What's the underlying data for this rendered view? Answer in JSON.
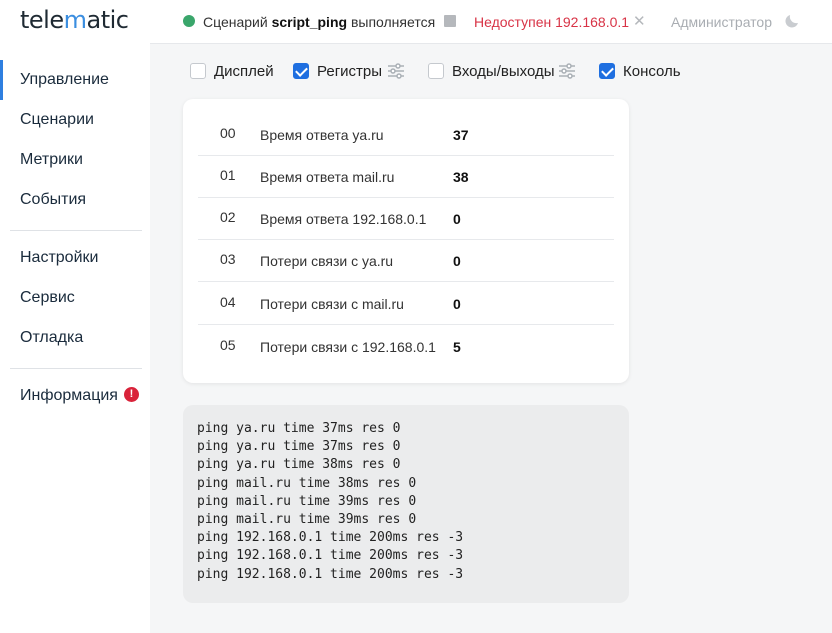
{
  "logo": {
    "text_a": "tele",
    "text_b": "m",
    "text_c": "atic"
  },
  "sidebar": {
    "items": [
      {
        "label": "Управление",
        "active": true
      },
      {
        "label": "Сценарии"
      },
      {
        "label": "Метрики"
      },
      {
        "label": "События"
      },
      {
        "label": "Настройки"
      },
      {
        "label": "Сервис"
      },
      {
        "label": "Отладка"
      },
      {
        "label": "Информация",
        "badge": "!"
      }
    ]
  },
  "topbar": {
    "status_prefix": "Сценарий",
    "script_name": "script_ping",
    "status_suffix": "выполняется",
    "status_color": "#3aa66b",
    "unreachable": "Недоступен 192.168.0.1",
    "unreachable_color": "#d83346",
    "user": "Администратор"
  },
  "toggles": [
    {
      "label": "Дисплей",
      "checked": false
    },
    {
      "label": "Регистры",
      "checked": true
    },
    {
      "label": "Входы/выходы",
      "checked": false
    },
    {
      "label": "Консоль",
      "checked": true
    }
  ],
  "registers": [
    {
      "index": "00",
      "name": "Время ответа ya.ru",
      "value": "37"
    },
    {
      "index": "01",
      "name": "Время ответа mail.ru",
      "value": "38"
    },
    {
      "index": "02",
      "name": "Время ответа 192.168.0.1",
      "value": "0"
    },
    {
      "index": "03",
      "name": "Потери связи с ya.ru",
      "value": "0"
    },
    {
      "index": "04",
      "name": "Потери связи с mail.ru",
      "value": "0"
    },
    {
      "index": "05",
      "name": "Потери связи с 192.168.0.1",
      "value": "5"
    }
  ],
  "console": [
    "ping ya.ru time 37ms res 0",
    "ping ya.ru time 37ms res 0",
    "ping ya.ru time 38ms res 0",
    "ping mail.ru time 38ms res 0",
    "ping mail.ru time 39ms res 0",
    "ping mail.ru time 39ms res 0",
    "ping 192.168.0.1 time 200ms res -3",
    "ping 192.168.0.1 time 200ms res -3",
    "ping 192.168.0.1 time 200ms res -3"
  ],
  "accent_color": "#1f6fe0"
}
